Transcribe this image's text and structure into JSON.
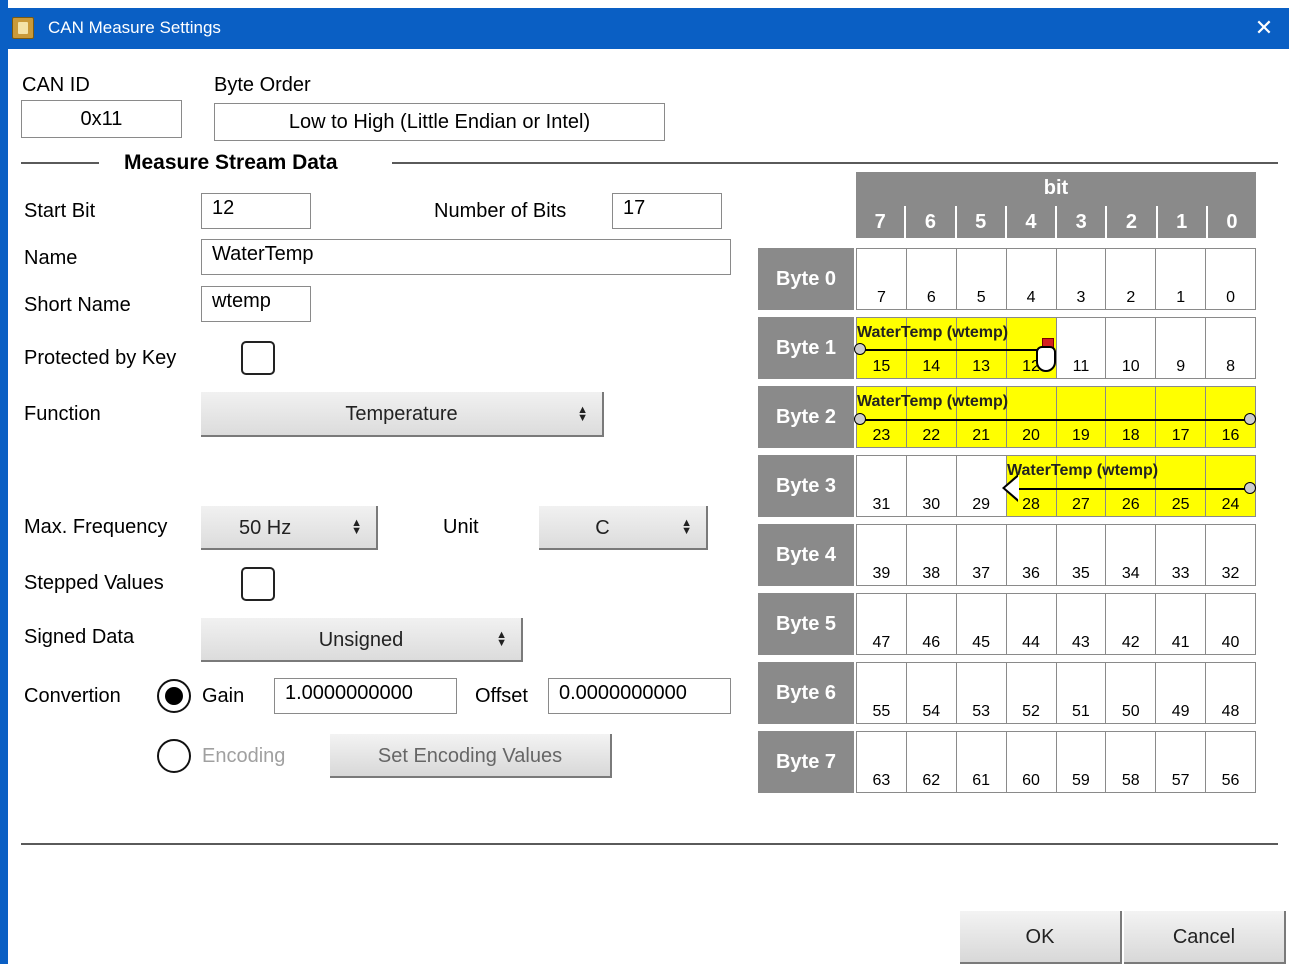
{
  "window": {
    "title": "CAN Measure Settings",
    "close_glyph": "✕"
  },
  "can_id": {
    "label": "CAN ID",
    "value": "0x11"
  },
  "byte_order": {
    "label": "Byte Order",
    "value": "Low to High (Little Endian or Intel)"
  },
  "section_title": "Measure Stream Data",
  "start_bit": {
    "label": "Start Bit",
    "value": "12"
  },
  "number_of_bits": {
    "label": "Number of Bits",
    "value": "17"
  },
  "name": {
    "label": "Name",
    "value": "WaterTemp"
  },
  "short_name": {
    "label": "Short Name",
    "value": "wtemp"
  },
  "protected_by_key": {
    "label": "Protected by Key",
    "checked": false
  },
  "function": {
    "label": "Function",
    "value": "Temperature"
  },
  "max_frequency": {
    "label": "Max. Frequency",
    "value": "50 Hz"
  },
  "unit": {
    "label": "Unit",
    "value": "C"
  },
  "stepped_values": {
    "label": "Stepped Values",
    "checked": false
  },
  "signed_data": {
    "label": "Signed Data",
    "value": "Unsigned"
  },
  "conversion": {
    "label": "Convertion",
    "gain_label": "Gain",
    "gain_value": "1.0000000000",
    "offset_label": "Offset",
    "offset_value": "0.0000000000",
    "encoding_label": "Encoding",
    "set_encoding_button": "Set Encoding Values",
    "selected": "gain"
  },
  "grid": {
    "bit_title": "bit",
    "bit_headers": [
      "7",
      "6",
      "5",
      "4",
      "3",
      "2",
      "1",
      "0"
    ],
    "rows": [
      {
        "label": "Byte 0",
        "bits": [
          "7",
          "6",
          "5",
          "4",
          "3",
          "2",
          "1",
          "0"
        ]
      },
      {
        "label": "Byte 1",
        "bits": [
          "15",
          "14",
          "13",
          "12",
          "11",
          "10",
          "9",
          "8"
        ]
      },
      {
        "label": "Byte 2",
        "bits": [
          "23",
          "22",
          "21",
          "20",
          "19",
          "18",
          "17",
          "16"
        ]
      },
      {
        "label": "Byte 3",
        "bits": [
          "31",
          "30",
          "29",
          "28",
          "27",
          "26",
          "25",
          "24"
        ]
      },
      {
        "label": "Byte 4",
        "bits": [
          "39",
          "38",
          "37",
          "36",
          "35",
          "34",
          "33",
          "32"
        ]
      },
      {
        "label": "Byte 5",
        "bits": [
          "47",
          "46",
          "45",
          "44",
          "43",
          "42",
          "41",
          "40"
        ]
      },
      {
        "label": "Byte 6",
        "bits": [
          "55",
          "54",
          "53",
          "52",
          "51",
          "50",
          "49",
          "48"
        ]
      },
      {
        "label": "Byte 7",
        "bits": [
          "63",
          "62",
          "61",
          "60",
          "59",
          "58",
          "57",
          "56"
        ]
      }
    ],
    "signal_label": "WaterTemp (wtemp)",
    "highlight_color": "#ffff00"
  },
  "buttons": {
    "ok": "OK",
    "cancel": "Cancel"
  },
  "colors": {
    "title_bar": "#0a5fc4",
    "grid_header": "#8a8a8a"
  }
}
